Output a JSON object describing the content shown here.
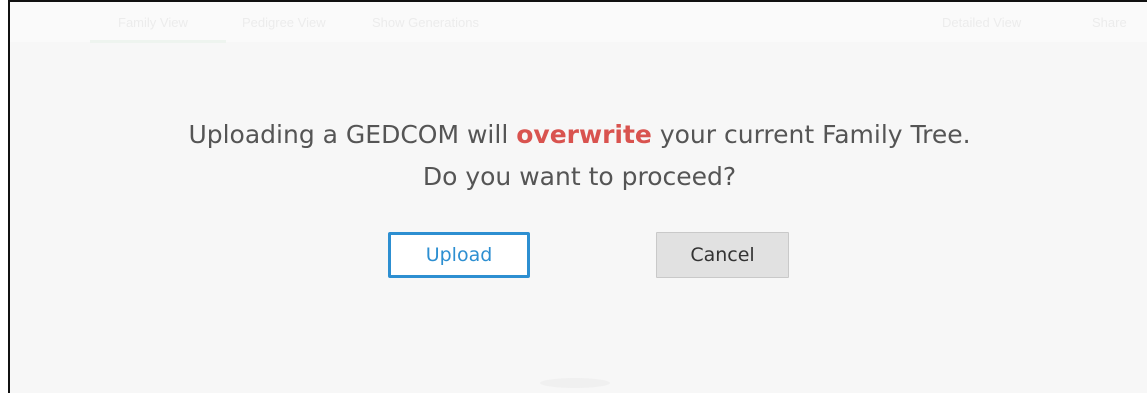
{
  "background_tabs": {
    "family_view": "Family View",
    "pedigree_view": "Pedigree View",
    "show_generations": "Show Generations",
    "detailed_view": "Detailed View",
    "share": "Share"
  },
  "dialog": {
    "line1_before": "Uploading a GEDCOM will ",
    "line1_emphasis": "overwrite",
    "line1_after": " your current Family Tree.",
    "line2": "Do you want to proceed?",
    "upload_label": "Upload",
    "cancel_label": "Cancel"
  },
  "colors": {
    "emphasis": "#d9534f",
    "upload_accent": "#2d8fd1",
    "cancel_bg": "#e1e1e1",
    "overlay_bg": "#f7f7f7"
  }
}
